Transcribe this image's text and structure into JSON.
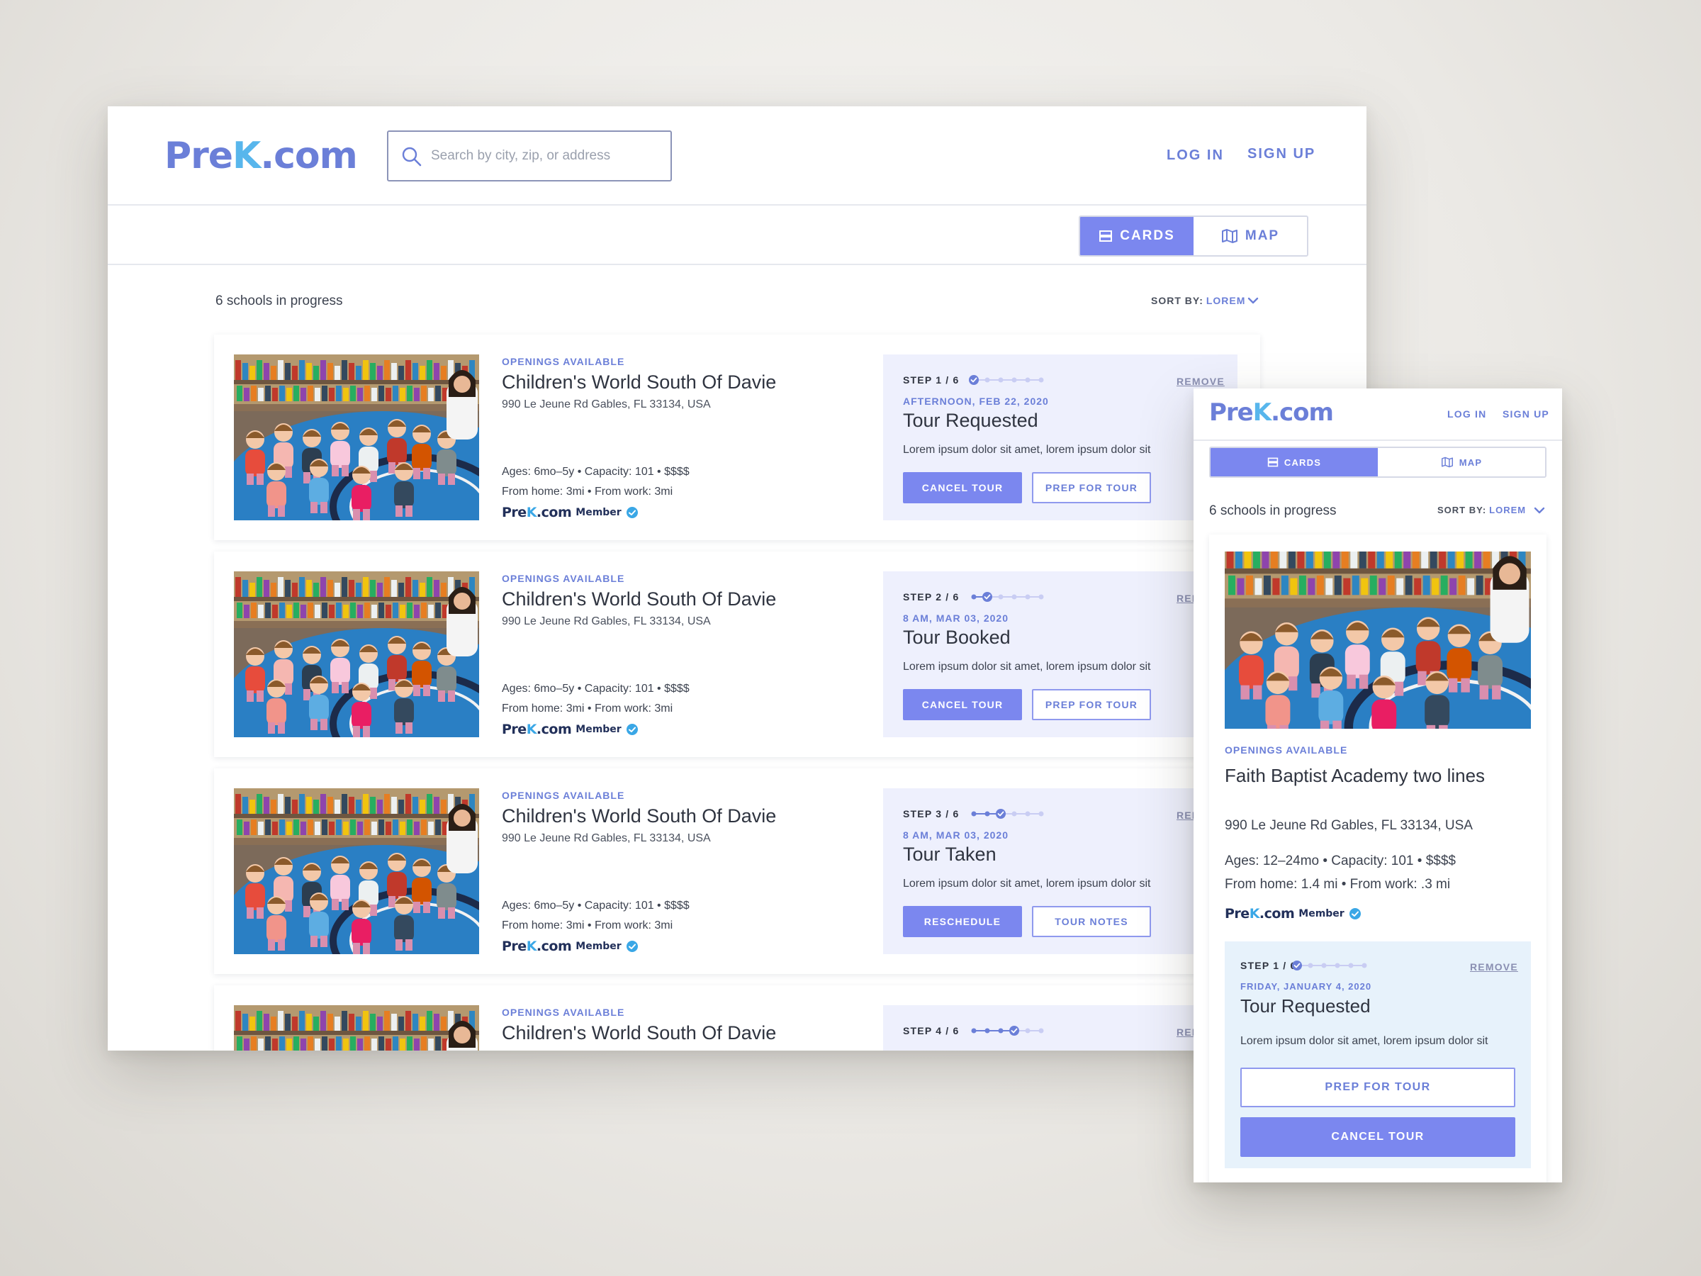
{
  "brand": {
    "part1": "Pre",
    "part2": "K",
    "part3": ".com"
  },
  "colors": {
    "accent": "#7b87ef",
    "link": "#6b7fd8",
    "brand_light": "#58b6ec",
    "panel_bg": "#eef0fd",
    "mobile_panel_bg": "#e7f2fb"
  },
  "desktop": {
    "search": {
      "placeholder": "Search by city, zip, or address",
      "value": ""
    },
    "nav": {
      "login": "LOG IN",
      "signup": "SIGN UP"
    },
    "view_toggle": {
      "cards": "CARDS",
      "map": "MAP",
      "active": "cards"
    },
    "count": "6 schools in progress",
    "sort": {
      "label": "SORT BY:",
      "value": "LOREM"
    },
    "cards": [
      {
        "openings": "OPENINGS AVAILABLE",
        "name": "Children's World South Of Davie",
        "address": "990 Le Jeune Rd Gables, FL 33134, USA",
        "details1": "Ages: 6mo–5y   •   Capacity: 101   •   $$$$",
        "details2": "From home: 3mi   •   From work: 3mi",
        "member": "Member",
        "step": "STEP 1 / 6",
        "step_current": 1,
        "step_total": 6,
        "remove": "REMOVE",
        "date": "AFTERNOON, FEB 22, 2020",
        "status": "Tour Requested",
        "desc": "Lorem ipsum dolor sit amet, lorem ipsum dolor sit",
        "btn_primary": "CANCEL TOUR",
        "btn_secondary": "PREP FOR TOUR"
      },
      {
        "openings": "OPENINGS AVAILABLE",
        "name": "Children's World South Of Davie",
        "address": "990 Le Jeune Rd Gables, FL 33134, USA",
        "details1": "Ages: 6mo–5y   •   Capacity: 101   •   $$$$",
        "details2": "From home: 3mi   •   From work: 3mi",
        "member": "Member",
        "step": "STEP 2 / 6",
        "step_current": 2,
        "step_total": 6,
        "remove": "REMOVE",
        "date": "8 AM, MAR 03, 2020",
        "status": "Tour Booked",
        "desc": "Lorem ipsum dolor sit amet, lorem ipsum dolor sit",
        "btn_primary": "CANCEL TOUR",
        "btn_secondary": "PREP FOR TOUR"
      },
      {
        "openings": "OPENINGS AVAILABLE",
        "name": "Children's World South Of Davie",
        "address": "990 Le Jeune Rd Gables, FL 33134, USA",
        "details1": "Ages: 6mo–5y   •   Capacity: 101   •   $$$$",
        "details2": "From home: 3mi   •   From work: 3mi",
        "member": "Member",
        "step": "STEP 3 / 6",
        "step_current": 3,
        "step_total": 6,
        "remove": "REMOVE",
        "date": "8 AM, MAR 03, 2020",
        "status": "Tour Taken",
        "desc": "Lorem ipsum dolor sit amet, lorem ipsum dolor sit",
        "btn_primary": "RESCHEDULE",
        "btn_secondary": "TOUR NOTES"
      },
      {
        "openings": "OPENINGS AVAILABLE",
        "name": "Children's World South Of Davie",
        "address": "",
        "details1": "",
        "details2": "",
        "member": "",
        "step": "STEP 4 / 6",
        "step_current": 4,
        "step_total": 6,
        "remove": "REMOVE",
        "date": "",
        "status": "",
        "desc": "",
        "btn_primary": "",
        "btn_secondary": ""
      }
    ]
  },
  "mobile": {
    "nav": {
      "login": "LOG IN",
      "signup": "SIGN UP"
    },
    "view_toggle": {
      "cards": "CARDS",
      "map": "MAP",
      "active": "cards"
    },
    "count": "6 schools in progress",
    "sort": {
      "label": "SORT BY:",
      "value": "LOREM"
    },
    "card": {
      "openings": "OPENINGS AVAILABLE",
      "name": "Faith Baptist Academy two lines",
      "address": "990 Le Jeune Rd Gables, FL 33134, USA",
      "details1": "Ages: 12–24mo   •   Capacity: 101   •   $$$$",
      "details2": "From home: 1.4 mi   •   From work: .3 mi",
      "member": "Member",
      "step": "STEP 1 / 6",
      "step_current": 1,
      "step_total": 6,
      "remove": "REMOVE",
      "date": "FRIDAY, JANUARY 4, 2020",
      "status": "Tour Requested",
      "desc": "Lorem ipsum dolor sit amet, lorem ipsum dolor sit",
      "btn_secondary": "PREP FOR TOUR",
      "btn_primary": "CANCEL TOUR"
    }
  }
}
